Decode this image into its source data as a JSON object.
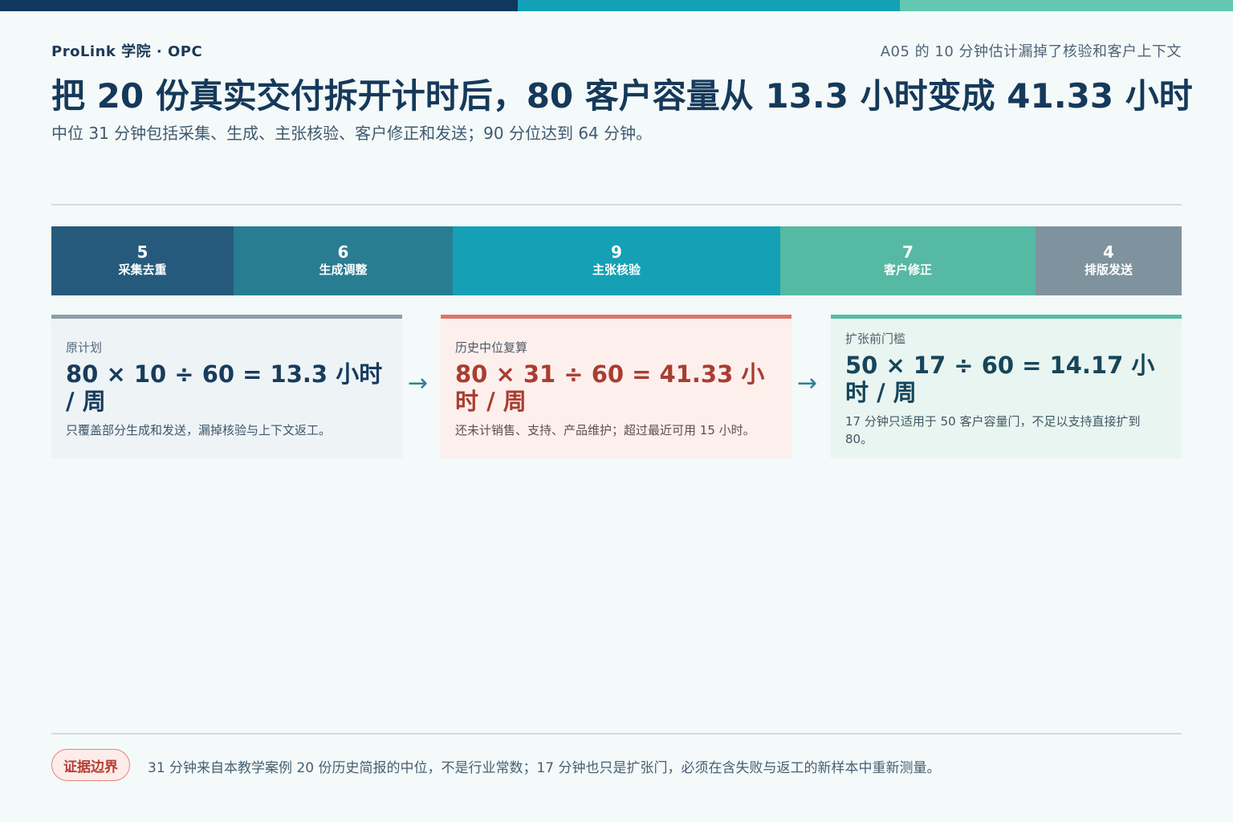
{
  "brand": "ProLink 学院 · OPC",
  "note_right": "A05 的 10 分钟估计漏掉了核验和客户上下文",
  "title": "把 20 份真实交付拆开计时后，80 客户容量从 13.3 小时变成 41.33 小时",
  "subtitle": "中位 31 分钟包括采集、生成、主张核验、客户修正和发送；90 分位达到 64 分钟。",
  "colors": {
    "topbar": [
      "#10385e",
      "#13a1b8",
      "#63c7b2"
    ],
    "stage_blue_dark": "#255a7c",
    "stage_teal_dark": "#287d92",
    "stage_teal": "#15a0b6",
    "stage_green": "#56b9a3",
    "stage_gray": "#7f939e",
    "red_accent": "#e07467",
    "green_accent": "#57bba3"
  },
  "stages": [
    {
      "minutes": "5",
      "label": "采集去重",
      "color": "#255a7c"
    },
    {
      "minutes": "6",
      "label": "生成调整",
      "color": "#287d92"
    },
    {
      "minutes": "9",
      "label": "主张核验",
      "color": "#15a0b6"
    },
    {
      "minutes": "7",
      "label": "客户修正",
      "color": "#56b9a3"
    },
    {
      "minutes": "4",
      "label": "排版发送",
      "color": "#7f939e"
    }
  ],
  "cards": {
    "original": {
      "label": "原计划",
      "formula": "80 × 10 ÷ 60 = 13.3 小时 / 周",
      "desc": "只覆盖部分生成和发送，漏掉核验与上下文返工。"
    },
    "history": {
      "label": "历史中位复算",
      "formula": "80 × 31 ÷ 60 = 41.33 小时 / 周",
      "desc": "还未计销售、支持、产品维护；超过最近可用 15 小时。"
    },
    "expansion": {
      "label": "扩张前门槛",
      "formula": "50 × 17 ÷ 60 = 14.17 小时 / 周",
      "desc": "17 分钟只适用于 50 客户容量门，不足以支持直接扩到 80。"
    }
  },
  "arrow_glyph": "→",
  "evidence": {
    "badge": "证据边界",
    "text": "31 分钟来自本教学案例 20 份历史简报的中位，不是行业常数；17 分钟也只是扩张门，必须在含失败与返工的新样本中重新测量。"
  }
}
